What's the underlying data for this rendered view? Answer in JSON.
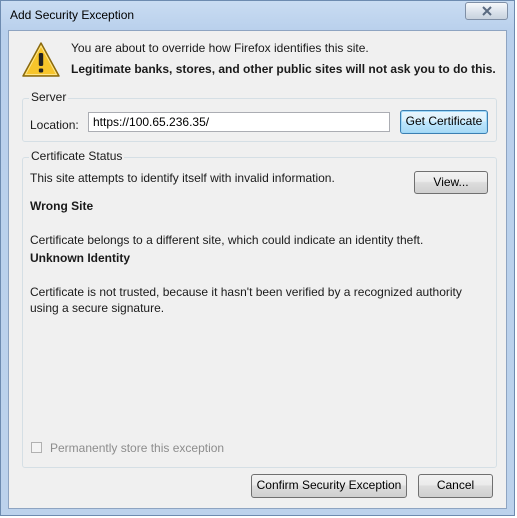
{
  "window": {
    "title": "Add Security Exception"
  },
  "intro": {
    "line1": "You are about to override how Firefox identifies this site.",
    "line2": "Legitimate banks, stores, and other public sites will not ask you to do this."
  },
  "server": {
    "group_label": "Server",
    "location_label": "Location:",
    "location_value": "https://100.65.236.35/",
    "get_certificate_label": "Get Certificate"
  },
  "certificate_status": {
    "group_label": "Certificate Status",
    "summary": "This site attempts to identify itself with invalid information.",
    "view_label": "View...",
    "issues": [
      {
        "title": "Wrong Site",
        "description": "Certificate belongs to a different site, which could indicate an identity theft."
      },
      {
        "title": "Unknown Identity",
        "description": "Certificate is not trusted, because it hasn't been verified by a recognized authority using a secure signature."
      }
    ]
  },
  "permanent_store": {
    "label": "Permanently store this exception",
    "checked": false,
    "enabled": false
  },
  "buttons": {
    "confirm_label": "Confirm Security Exception",
    "cancel_label": "Cancel"
  },
  "icons": {
    "warning": "warning-triangle-icon",
    "close": "close-icon"
  }
}
